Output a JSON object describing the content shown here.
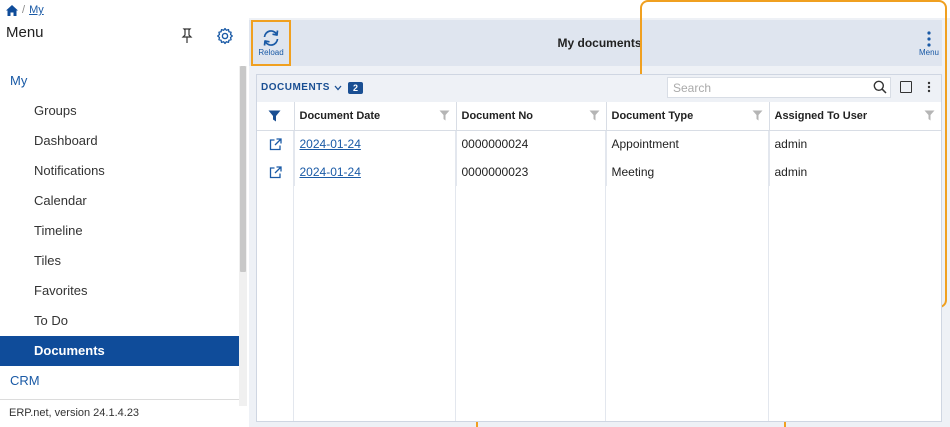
{
  "breadcrumb": {
    "current": "My"
  },
  "sidebar": {
    "title": "Menu",
    "items": [
      {
        "label": "My",
        "type": "group"
      },
      {
        "label": "Groups",
        "type": "item"
      },
      {
        "label": "Dashboard",
        "type": "item"
      },
      {
        "label": "Notifications",
        "type": "item"
      },
      {
        "label": "Calendar",
        "type": "item"
      },
      {
        "label": "Timeline",
        "type": "item"
      },
      {
        "label": "Tiles",
        "type": "item"
      },
      {
        "label": "Favorites",
        "type": "item"
      },
      {
        "label": "To Do",
        "type": "item"
      },
      {
        "label": "Documents",
        "type": "item",
        "active": true
      },
      {
        "label": "CRM",
        "type": "group"
      }
    ],
    "version": "ERP.net, version 24.1.4.23"
  },
  "toolbar": {
    "reload_label": "Reload",
    "page_title": "My documents",
    "menu_label": "Menu"
  },
  "panel": {
    "title": "DOCUMENTS",
    "count": "2",
    "search_placeholder": "Search",
    "columns": [
      "Document Date",
      "Document No",
      "Document Type",
      "Assigned To User"
    ],
    "rows": [
      {
        "date": "2024-01-24",
        "no": "0000000024",
        "type": "Appointment",
        "user": "admin"
      },
      {
        "date": "2024-01-24",
        "no": "0000000023",
        "type": "Meeting",
        "user": "admin"
      }
    ]
  },
  "colors": {
    "accent": "#0f4c9a",
    "link": "#1a5aa6",
    "highlight_frame": "#f0a020",
    "toolbar_bg": "#dfe5ef"
  }
}
